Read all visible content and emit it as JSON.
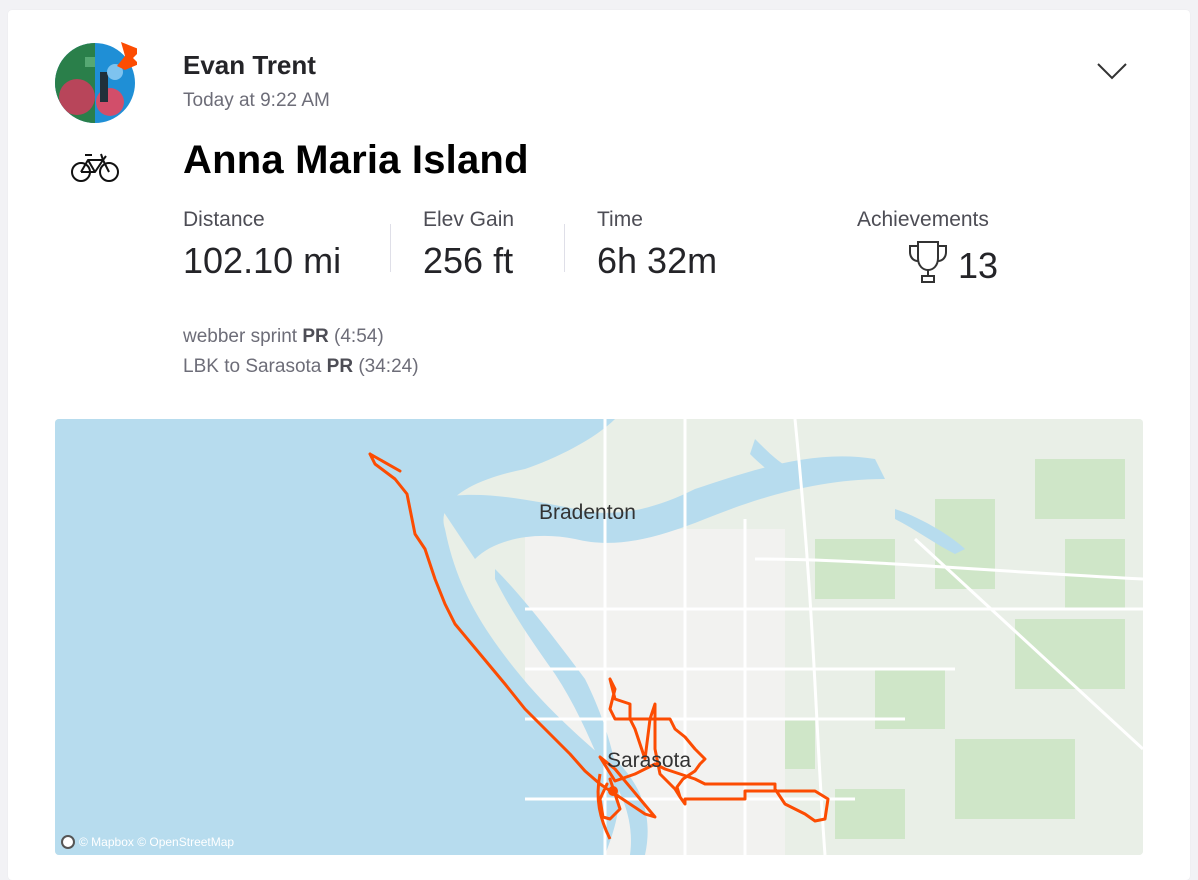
{
  "header": {
    "athlete_name": "Evan Trent",
    "timestamp": "Today at 9:22 AM"
  },
  "activity": {
    "type_icon": "bike-icon",
    "title": "Anna Maria Island"
  },
  "stats": {
    "distance": {
      "label": "Distance",
      "value": "102.10 mi"
    },
    "elev_gain": {
      "label": "Elev Gain",
      "value": "256 ft"
    },
    "time": {
      "label": "Time",
      "value": "6h 32m"
    },
    "achievements": {
      "label": "Achievements",
      "value": "13",
      "icon": "trophy-icon"
    }
  },
  "segments": [
    {
      "name": "webber sprint",
      "badge": "PR",
      "time": "(4:54)"
    },
    {
      "name": "LBK to Sarasota",
      "badge": "PR",
      "time": "(34:24)"
    }
  ],
  "map": {
    "labels": {
      "city1": "Bradenton",
      "city2": "Sarasota"
    },
    "attribution": "© Mapbox © OpenStreetMap",
    "route_color": "#fc4c02",
    "water_color": "#b7dcee",
    "land_color": "#e9efe7"
  }
}
